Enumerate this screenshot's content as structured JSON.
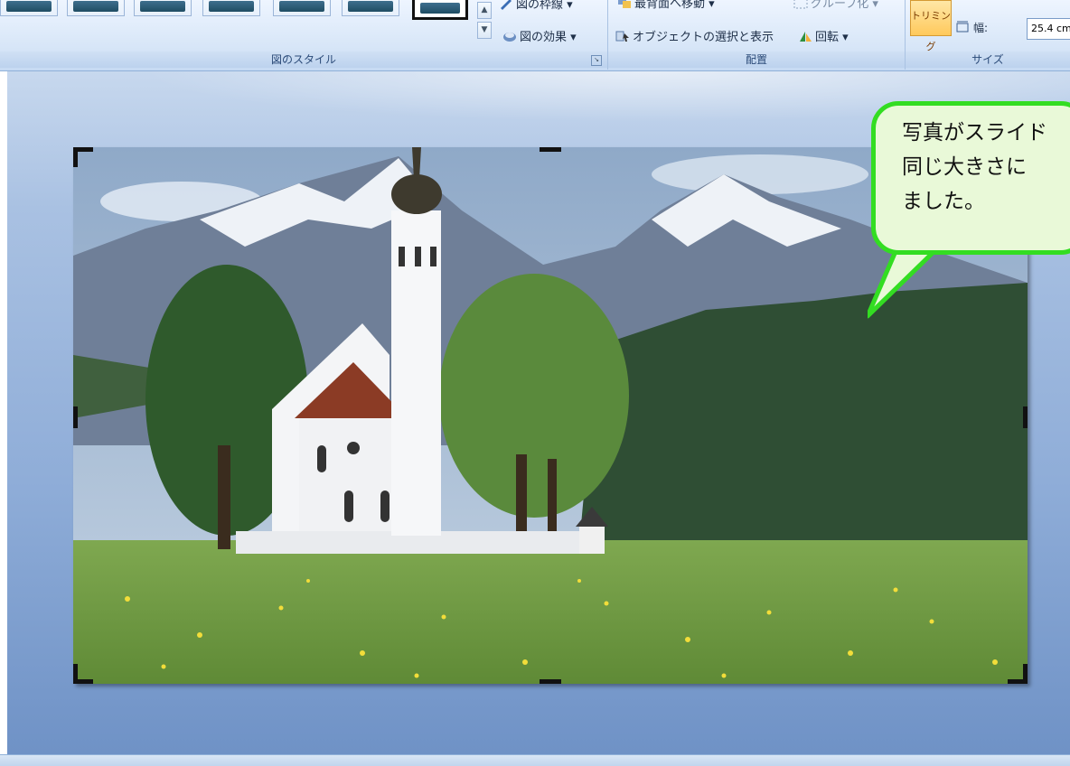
{
  "ribbon": {
    "picture_styles": {
      "group_label": "図のスタイル",
      "border_label": "図の枠線",
      "effects_label": "図の効果",
      "thumbnail_count": 7
    },
    "arrange": {
      "group_label": "配置",
      "bring_front_label": "最背面へ移動",
      "selection_pane_label": "オブジェクトの選択と表示",
      "group_obj_label": "グループ化",
      "rotate_label": "回転"
    },
    "size": {
      "group_label": "サイズ",
      "crop_label": "トリミング",
      "width_label": "幅:",
      "width_value": "25.4 cm"
    }
  },
  "callout": {
    "text": "写真がスライド\n同じ大きさに\nました。",
    "border_color": "#33dd22",
    "fill_color": "#e9f9d8"
  }
}
